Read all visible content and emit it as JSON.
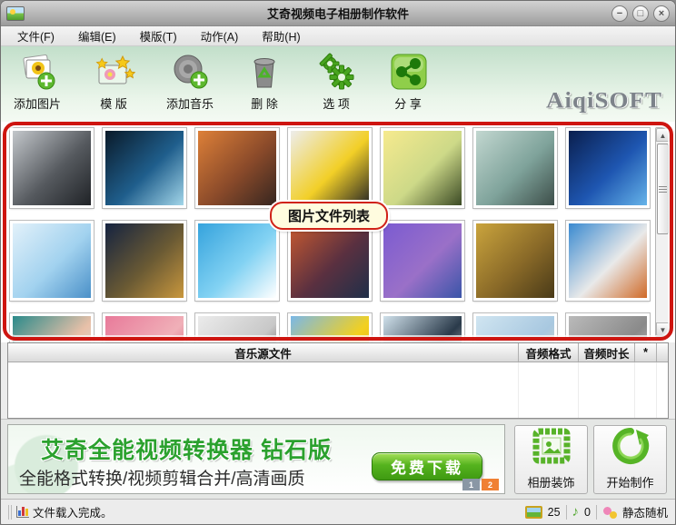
{
  "window": {
    "title": "艾奇视频电子相册制作软件",
    "controls": {
      "minimize": "−",
      "maximize": "□",
      "close": "×"
    }
  },
  "menu": {
    "items": [
      {
        "label": "文件(F)"
      },
      {
        "label": "编辑(E)"
      },
      {
        "label": "模版(T)"
      },
      {
        "label": "动作(A)"
      },
      {
        "label": "帮助(H)"
      }
    ]
  },
  "toolbar": {
    "buttons": [
      {
        "icon": "add-image-icon",
        "label": "添加图片"
      },
      {
        "icon": "template-icon",
        "label": "模 版"
      },
      {
        "icon": "add-music-icon",
        "label": "添加音乐"
      },
      {
        "icon": "delete-icon",
        "label": "删 除"
      },
      {
        "icon": "options-icon",
        "label": "选 项"
      },
      {
        "icon": "share-icon",
        "label": "分 享"
      }
    ],
    "logo": "AiqiSOFT"
  },
  "grid": {
    "tooltip": "图片文件列表",
    "thumbnails": [
      {
        "name": "eiffel-tower-bw",
        "colors": [
          "#c3c7cb",
          "#565a5f",
          "#202327"
        ]
      },
      {
        "name": "earth-from-space",
        "colors": [
          "#0a1a29",
          "#1f5e8c",
          "#a3d6e9"
        ]
      },
      {
        "name": "stonehenge-sunset",
        "colors": [
          "#dd8038",
          "#8a4a2a",
          "#362620"
        ]
      },
      {
        "name": "zen-stones-flowers",
        "colors": [
          "#ededed",
          "#f2cf27",
          "#262626"
        ]
      },
      {
        "name": "duckling",
        "colors": [
          "#f6ea8e",
          "#cdd988",
          "#3b4a25"
        ]
      },
      {
        "name": "ferris-wheel",
        "colors": [
          "#c2d7d0",
          "#7fa39b",
          "#3d4e49"
        ]
      },
      {
        "name": "harbour-bridge-night",
        "colors": [
          "#0a1f4e",
          "#1e56b1",
          "#66b4e9"
        ]
      },
      {
        "name": "eiffel-tower-blue",
        "colors": [
          "#e2f1fa",
          "#a2d2ef",
          "#4a90c8"
        ]
      },
      {
        "name": "colosseum-night",
        "colors": [
          "#152340",
          "#6a5a34",
          "#c9973d"
        ]
      },
      {
        "name": "water-wave",
        "colors": [
          "#35a3dd",
          "#82d2f3",
          "#ffffff"
        ]
      },
      {
        "name": "castle-sunset",
        "colors": [
          "#c85a30",
          "#5a3040",
          "#1f2f49"
        ]
      },
      {
        "name": "tower-bridge-purple",
        "colors": [
          "#7b5bd1",
          "#9a70c8",
          "#3a55a8"
        ]
      },
      {
        "name": "eiffel-tower-sepia",
        "colors": [
          "#caa43d",
          "#8a6a28",
          "#493a18"
        ]
      },
      {
        "name": "monument-valley",
        "colors": [
          "#3a8ad0",
          "#e9e9e9",
          "#d06a28"
        ]
      },
      {
        "name": "face-teal-hair",
        "colors": [
          "#2a8a8a",
          "#e8c0a8",
          "#d2e9f1"
        ]
      },
      {
        "name": "woman-in-pink",
        "colors": [
          "#e87a9a",
          "#f0b0b8",
          "#c83a5a"
        ]
      },
      {
        "name": "girl-with-newspaper",
        "colors": [
          "#ebebeb",
          "#c8c8c8",
          "#382e2e"
        ]
      },
      {
        "name": "yellow-tulip",
        "colors": [
          "#7ab8e8",
          "#f2d020",
          "#e8a010"
        ]
      },
      {
        "name": "penguins",
        "colors": [
          "#d0e1eb",
          "#2a3a4a",
          "#f0f0f0"
        ]
      },
      {
        "name": "beach-scene",
        "colors": [
          "#d0e5f1",
          "#a8c8e0",
          "#e8d8b8"
        ]
      },
      {
        "name": "koala",
        "colors": [
          "#bababa",
          "#8a8a8a",
          "#dadada"
        ]
      }
    ]
  },
  "music_table": {
    "headers": {
      "name": "音乐源文件",
      "format": "音频格式",
      "duration": "音频时长",
      "star": "*"
    }
  },
  "banner": {
    "title": "艾奇全能视频转换器 钻石版",
    "subtitle": "全能格式转换/视频剪辑合并/高清画质",
    "download_label": "免费下载",
    "pages": [
      {
        "label": "1",
        "color": "#8a97a5"
      },
      {
        "label": "2",
        "color": "#f08033"
      }
    ]
  },
  "actions": {
    "decorate_label": "相册装饰",
    "start_label": "开始制作"
  },
  "statusbar": {
    "message": "文件载入完成。",
    "image_count": "25",
    "music_count": "0",
    "mode": "静态随机"
  },
  "colors": {
    "annotation_red": "#ce1510",
    "accent_green": "#4caf2a",
    "banner_title_green": "#2ba12e",
    "pager_orange": "#f08033"
  }
}
